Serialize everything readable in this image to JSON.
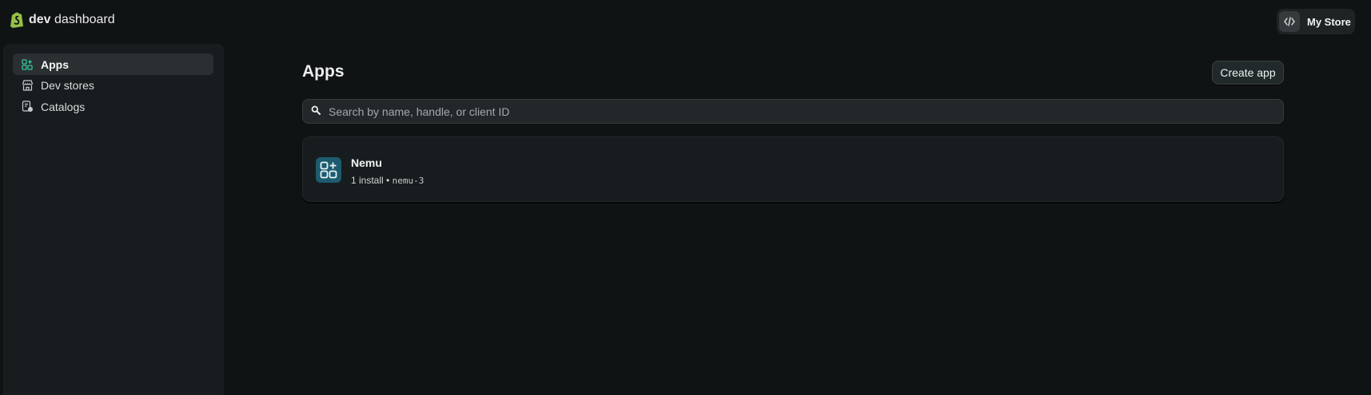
{
  "header": {
    "brand_bold": "dev",
    "brand_rest": "dashboard",
    "store_label": "My Store"
  },
  "sidebar": {
    "items": [
      {
        "label": "Apps",
        "icon": "apps-icon",
        "active": true
      },
      {
        "label": "Dev stores",
        "icon": "store-icon",
        "active": false
      },
      {
        "label": "Catalogs",
        "icon": "catalog-icon",
        "active": false
      }
    ]
  },
  "main": {
    "title": "Apps",
    "create_label": "Create app",
    "search": {
      "placeholder": "Search by name, handle, or client ID",
      "value": ""
    },
    "apps": [
      {
        "name": "Nemu",
        "installs": "1 install",
        "separator": "•",
        "handle": "nemu-3"
      }
    ]
  },
  "colors": {
    "background": "#0f1313",
    "sidebar": "#171d1e",
    "brand_green": "#95bf47",
    "app_icon_bg": "#1d5b6f",
    "active_icon": "#36c29a"
  }
}
